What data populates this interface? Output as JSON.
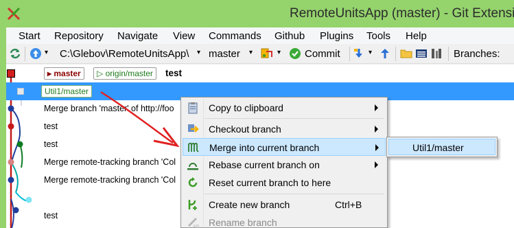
{
  "window": {
    "title": "RemoteUnitsApp (master) - Git Extensions",
    "title_visible": "RemoteUnitsApp (master) - Git Extensio",
    "logo_icon": "git-extensions-logo-icon",
    "accent_color": "#95d36d"
  },
  "menubar": {
    "items": [
      "Start",
      "Repository",
      "Navigate",
      "View",
      "Commands",
      "Github",
      "Plugins",
      "Tools",
      "Help"
    ]
  },
  "toolbar": {
    "path": "C:\\Glebov\\RemoteUnitsApp\\",
    "branch": "master",
    "commit_label": "Commit",
    "branches_label": "Branches:"
  },
  "grid": {
    "rows": [
      {
        "refs": [
          {
            "label": "master",
            "kind": "local"
          },
          {
            "label": "origin/master",
            "kind": "remote"
          }
        ],
        "message": "test",
        "selected": false
      },
      {
        "refs": [
          {
            "label": "Util1/master",
            "kind": "util"
          }
        ],
        "message": "",
        "selected": true
      },
      {
        "refs": [],
        "message": "Merge branch 'master' of http://foo",
        "selected": false
      },
      {
        "refs": [],
        "message": "test",
        "selected": false
      },
      {
        "refs": [],
        "message": "test",
        "selected": false
      },
      {
        "refs": [],
        "message": "Merge remote-tracking branch 'Col",
        "selected": false
      },
      {
        "refs": [],
        "message": "Merge remote-tracking branch 'Col",
        "selected": false
      },
      {
        "refs": [],
        "message": "",
        "selected": false
      },
      {
        "refs": [],
        "message": "test",
        "selected": false
      }
    ]
  },
  "context_menu": {
    "items": [
      {
        "label": "Copy to clipboard",
        "icon": "clipboard-icon",
        "submenu": true
      },
      {
        "label": "Checkout branch",
        "icon": "checkout-branch-icon",
        "submenu": true
      },
      {
        "label": "Merge into current branch",
        "icon": "merge-icon",
        "submenu": true,
        "highlighted": true
      },
      {
        "label": "Rebase current branch on",
        "icon": "rebase-icon",
        "submenu": true
      },
      {
        "label": "Reset current branch to here",
        "icon": "reset-icon",
        "submenu": false
      },
      {
        "label": "Create new branch",
        "icon": "create-branch-icon",
        "shortcut": "Ctrl+B"
      },
      {
        "label": "Rename branch",
        "icon": "rename-branch-icon",
        "disabled": true
      }
    ],
    "submenu_items": [
      "Util1/master"
    ]
  }
}
